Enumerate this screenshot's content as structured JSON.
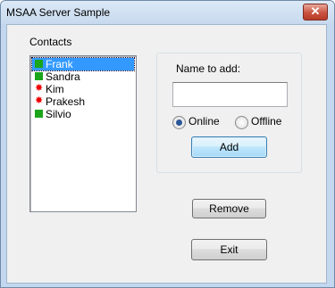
{
  "window": {
    "title": "MSAA Server Sample",
    "close_glyph": "✕"
  },
  "contacts": {
    "label": "Contacts",
    "items": [
      {
        "name": "Frank",
        "status": "online",
        "selected": true
      },
      {
        "name": "Sandra",
        "status": "online",
        "selected": false
      },
      {
        "name": "Kim",
        "status": "offline",
        "selected": false
      },
      {
        "name": "Prakesh",
        "status": "offline",
        "selected": false
      },
      {
        "name": "Silvio",
        "status": "online",
        "selected": false
      }
    ]
  },
  "add_panel": {
    "name_label": "Name to add:",
    "name_value": "",
    "radio_online": "Online",
    "radio_offline": "Offline",
    "selected_status": "Online",
    "add_label": "Add"
  },
  "buttons": {
    "remove_label": "Remove",
    "exit_label": "Exit"
  },
  "colors": {
    "online": "#1aa51a",
    "offline": "#e00000",
    "selection": "#3399ff"
  }
}
